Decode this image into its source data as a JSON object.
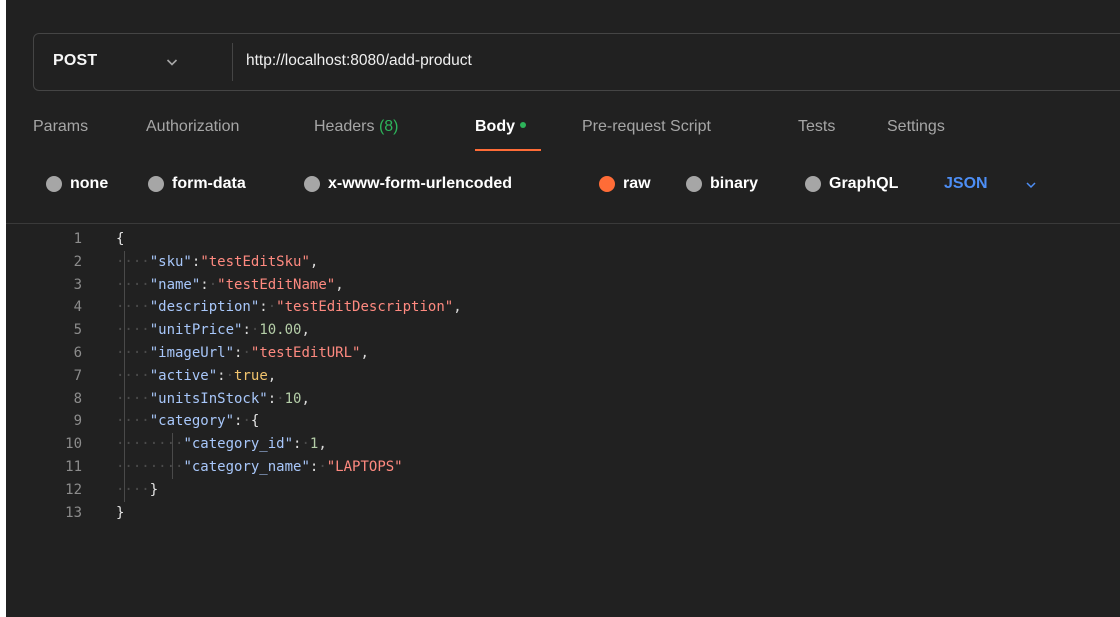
{
  "request": {
    "method": "POST",
    "url": "http://localhost:8080/add-product"
  },
  "tabs": [
    {
      "label": "Params"
    },
    {
      "label": "Authorization"
    },
    {
      "label": "Headers",
      "count": "(8)"
    },
    {
      "label": "Body"
    },
    {
      "label": "Pre-request Script"
    },
    {
      "label": "Tests"
    },
    {
      "label": "Settings"
    }
  ],
  "body_types": [
    {
      "label": "none"
    },
    {
      "label": "form-data"
    },
    {
      "label": "x-www-form-urlencoded"
    },
    {
      "label": "raw"
    },
    {
      "label": "binary"
    },
    {
      "label": "GraphQL"
    }
  ],
  "selected_body_type": "raw",
  "format": "JSON",
  "colors": {
    "accent": "#ff6c37",
    "count": "#2db35a",
    "format": "#4d8ef5",
    "background": "#212121"
  },
  "editor": {
    "lines": [
      {
        "num": "1",
        "indent": 0,
        "tokens": [
          [
            "brace",
            "{"
          ]
        ]
      },
      {
        "num": "2",
        "indent": 1,
        "tokens": [
          [
            "key",
            "\"sku\""
          ],
          [
            "p",
            ":"
          ],
          [
            "s",
            "\"testEditSku\""
          ],
          [
            "p",
            ","
          ]
        ]
      },
      {
        "num": "3",
        "indent": 1,
        "tokens": [
          [
            "key",
            "\"name\""
          ],
          [
            "p",
            ":"
          ],
          [
            "ws",
            "·"
          ],
          [
            "s",
            "\"testEditName\""
          ],
          [
            "p",
            ","
          ]
        ]
      },
      {
        "num": "4",
        "indent": 1,
        "tokens": [
          [
            "key",
            "\"description\""
          ],
          [
            "p",
            ":"
          ],
          [
            "ws",
            "·"
          ],
          [
            "s",
            "\"testEditDescription\""
          ],
          [
            "p",
            ","
          ]
        ]
      },
      {
        "num": "5",
        "indent": 1,
        "tokens": [
          [
            "key",
            "\"unitPrice\""
          ],
          [
            "p",
            ":"
          ],
          [
            "ws",
            "·"
          ],
          [
            "n",
            "10.00"
          ],
          [
            "p",
            ","
          ]
        ]
      },
      {
        "num": "6",
        "indent": 1,
        "tokens": [
          [
            "key",
            "\"imageUrl\""
          ],
          [
            "p",
            ":"
          ],
          [
            "ws",
            "·"
          ],
          [
            "s",
            "\"testEditURL\""
          ],
          [
            "p",
            ","
          ]
        ]
      },
      {
        "num": "7",
        "indent": 1,
        "tokens": [
          [
            "key",
            "\"active\""
          ],
          [
            "p",
            ":"
          ],
          [
            "ws",
            "·"
          ],
          [
            "b",
            "true"
          ],
          [
            "p",
            ","
          ]
        ]
      },
      {
        "num": "8",
        "indent": 1,
        "tokens": [
          [
            "key",
            "\"unitsInStock\""
          ],
          [
            "p",
            ":"
          ],
          [
            "ws",
            "·"
          ],
          [
            "n",
            "10"
          ],
          [
            "p",
            ","
          ]
        ]
      },
      {
        "num": "9",
        "indent": 1,
        "tokens": [
          [
            "key",
            "\"category\""
          ],
          [
            "p",
            ":"
          ],
          [
            "ws",
            "·"
          ],
          [
            "brace",
            "{"
          ]
        ]
      },
      {
        "num": "10",
        "indent": 2,
        "tokens": [
          [
            "key",
            "\"category_id\""
          ],
          [
            "p",
            ":"
          ],
          [
            "ws",
            "·"
          ],
          [
            "n",
            "1"
          ],
          [
            "p",
            ","
          ]
        ]
      },
      {
        "num": "11",
        "indent": 2,
        "tokens": [
          [
            "key",
            "\"category_name\""
          ],
          [
            "p",
            ":"
          ],
          [
            "ws",
            "·"
          ],
          [
            "s",
            "\"LAPTOPS\""
          ]
        ]
      },
      {
        "num": "12",
        "indent": 1,
        "tokens": [
          [
            "brace",
            "}"
          ]
        ]
      },
      {
        "num": "13",
        "indent": 0,
        "tokens": [
          [
            "brace",
            "}"
          ]
        ]
      }
    ]
  }
}
